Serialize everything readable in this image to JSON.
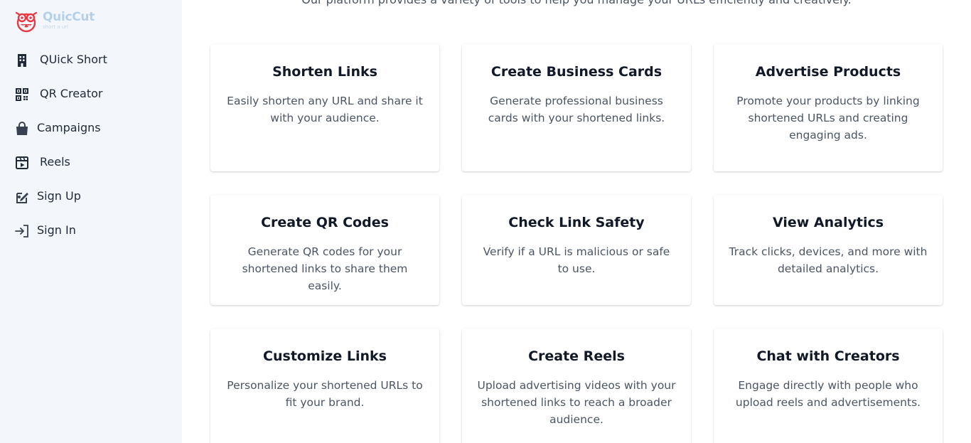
{
  "brand": {
    "name": "QuicCut",
    "tagline": "short a url"
  },
  "sidebar": {
    "items": [
      {
        "label": "QUick Short",
        "icon": "building-icon"
      },
      {
        "label": "QR Creator",
        "icon": "qr-code-icon"
      },
      {
        "label": "Campaigns",
        "icon": "shopping-bag-icon"
      },
      {
        "label": "Reels",
        "icon": "video-reel-icon"
      },
      {
        "label": "Sign Up",
        "icon": "edit-signup-icon"
      },
      {
        "label": "Sign In",
        "icon": "sign-in-icon"
      }
    ]
  },
  "main": {
    "intro": "Our platform provides a variety of tools to help you manage your URLs efficiently and creatively.",
    "cards": [
      {
        "title": "Shorten Links",
        "description": "Easily shorten any URL and share it with your audience."
      },
      {
        "title": "Create Business Cards",
        "description": "Generate professional business cards with your shortened links."
      },
      {
        "title": "Advertise Products",
        "description": "Promote your products by linking shortened URLs and creating engaging ads."
      },
      {
        "title": "Create QR Codes",
        "description": "Generate QR codes for your shortened links to share them easily."
      },
      {
        "title": "Check Link Safety",
        "description": "Verify if a URL is malicious or safe to use."
      },
      {
        "title": "View Analytics",
        "description": "Track clicks, devices, and more with detailed analytics."
      },
      {
        "title": "Customize Links",
        "description": "Personalize your shortened URLs to fit your brand."
      },
      {
        "title": "Create Reels",
        "description": "Upload advertising videos with your shortened links to reach a broader audience."
      },
      {
        "title": "Chat with Creators",
        "description": "Engage directly with people who upload reels and advertisements."
      }
    ]
  },
  "colors": {
    "sidebar_bg": "#f3f6fb",
    "logo_red": "#e63946",
    "logo_text": "#b6d0ea"
  }
}
